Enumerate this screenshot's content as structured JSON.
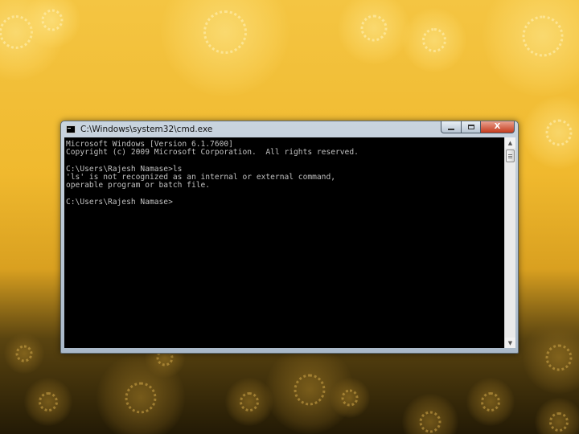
{
  "window": {
    "title": "C:\\Windows\\system32\\cmd.exe",
    "controls": {
      "minimize": "",
      "maximize": "",
      "close": "X"
    }
  },
  "console": {
    "lines": [
      "Microsoft Windows [Version 6.1.7600]",
      "Copyright (c) 2009 Microsoft Corporation.  All rights reserved.",
      "",
      "C:\\Users\\Rajesh Namase>ls",
      "'ls' is not recognized as an internal or external command,",
      "operable program or batch file.",
      "",
      "C:\\Users\\Rajesh Namase>"
    ]
  },
  "scrollbar": {
    "up_glyph": "▲",
    "down_glyph": "▼"
  },
  "icons": {
    "app": "cmd-app-icon",
    "minimize": "minimize-icon",
    "maximize": "maximize-icon",
    "close": "close-icon"
  }
}
